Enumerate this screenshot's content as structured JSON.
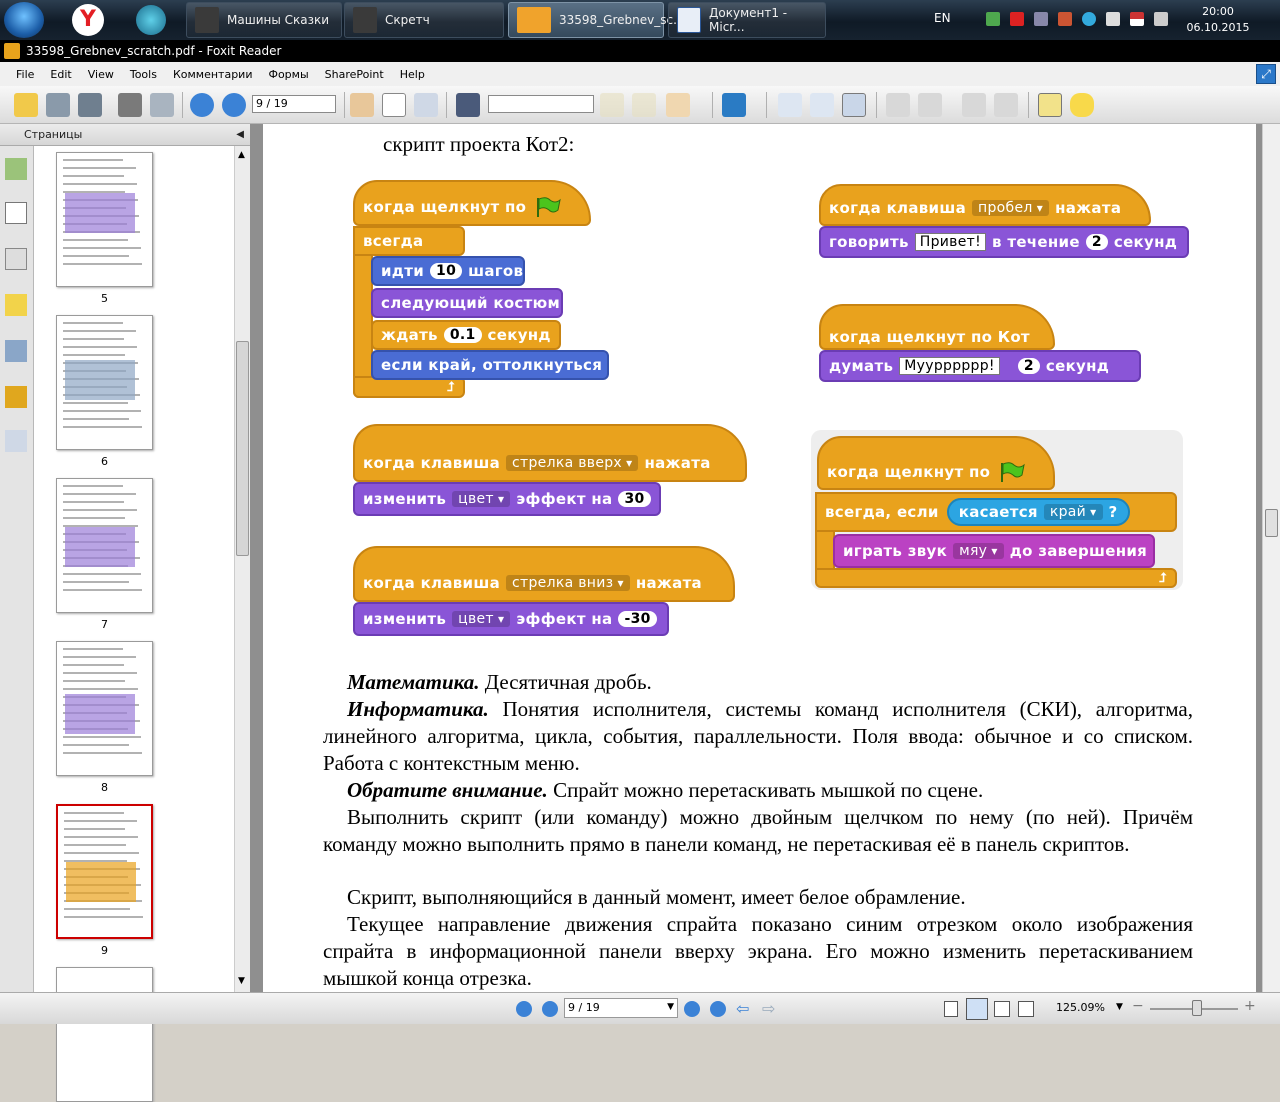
{
  "taskbar": {
    "windows": [
      "Машины Сказки",
      "Скретч",
      "33598_Grebnev_sc...",
      "Документ1 - Micr..."
    ],
    "lang": "EN",
    "time": "20:00",
    "date": "06.10.2015"
  },
  "window": {
    "title": "33598_Grebnev_scratch.pdf - Foxit Reader"
  },
  "menu": [
    "File",
    "Edit",
    "View",
    "Tools",
    "Комментарии",
    "Формы",
    "SharePoint",
    "Help"
  ],
  "toolbar": {
    "page_value": "9 / 19"
  },
  "sidebar": {
    "title": "Страницы",
    "thumbnails": [
      "5",
      "6",
      "7",
      "8",
      "9"
    ]
  },
  "document": {
    "caption": "скрипт проекта Кот2:",
    "script1": {
      "hat": "когда щелкнут по",
      "forever": "всегда",
      "move": "идти",
      "move_n": "10",
      "move_unit": "шагов",
      "costume": "следующий костюм",
      "wait": "ждать",
      "wait_n": "0.1",
      "wait_unit": "секунд",
      "bounce": "если край, оттолкнуться"
    },
    "script2": {
      "hat_a": "когда клавиша",
      "key": "пробел",
      "hat_b": "нажата",
      "say": "говорить",
      "say_text": "Привет!",
      "say_mid": "в течение",
      "say_n": "2",
      "say_unit": "секунд"
    },
    "script3": {
      "hat": "когда щелкнут по  Кот",
      "think": "думать",
      "think_text": "Муурррррр!",
      "think_n": "2",
      "think_unit": "секунд"
    },
    "script4": {
      "hat_a": "когда клавиша",
      "key": "стрелка вверх",
      "hat_b": "нажата",
      "change": "изменить",
      "effect": "цвет",
      "change_mid": "эффект на",
      "change_n": "30"
    },
    "script5": {
      "hat": "когда щелкнут по",
      "forever_if": "всегда, если",
      "touching": "касается",
      "target": "край",
      "q": "?",
      "play": "играть звук",
      "sound": "мяу",
      "until": "до завершения"
    },
    "script6": {
      "hat_a": "когда клавиша",
      "key": "стрелка вниз",
      "hat_b": "нажата",
      "change": "изменить",
      "effect": "цвет",
      "change_mid": "эффект на",
      "change_n": "-30"
    },
    "p1_b": "Математика.",
    "p1": " Десятичная дробь.",
    "p2_b": "Информатика.",
    "p2": " Понятия исполнителя, системы команд исполнителя (СКИ), алгоритма, линейного алгоритма, цикла, события, параллельности. Поля ввода: обычное и со списком. Работа с контекстным меню.",
    "p3_b": "Обратите внимание.",
    "p3": " Спрайт можно перетаскивать мышкой по сцене.",
    "p4": "Выполнить скрипт (или команду) можно двойным щелчком по нему (по ней). Причём команду можно выполнить прямо в панели команд, не перетаскивая её в панель скриптов.",
    "p5": "Скрипт, выполняющийся в данный момент, имеет белое обрамление.",
    "p6": "Текущее направление движения спрайта показано синим отрезком около изображения спрайта в информационной панели вверху экрана. Его можно изменить перетаскиванием мышкой конца отрезка."
  },
  "statusbar": {
    "page_value": "9 / 19",
    "zoom": "125.09%"
  },
  "colors": {
    "control": "#e9a21d",
    "motion": "#4a6cd4",
    "looks": "#8a55d7",
    "sound": "#bb42c3",
    "sensing": "#2ca5e2"
  }
}
